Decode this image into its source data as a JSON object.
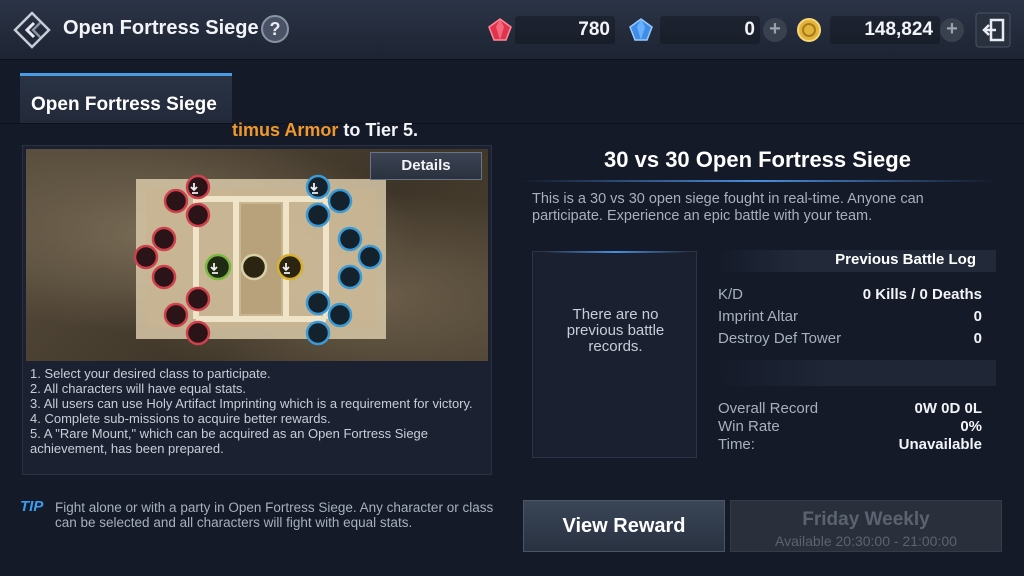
{
  "header": {
    "title": "Open Fortress Siege",
    "help_label": "?",
    "currencies": [
      {
        "icon": "red-gem-icon",
        "value": "780",
        "color": "#e0344e"
      },
      {
        "icon": "blue-gem-icon",
        "value": "0",
        "color": "#3e8ee8"
      },
      {
        "icon": "gold-coin-icon",
        "value": "148,824",
        "color": "#e2b43c"
      }
    ],
    "plus_label": "+"
  },
  "tab": {
    "label": "Open Fortress Siege",
    "accent": "#4a9ae6"
  },
  "banner": {
    "highlight": "timus Armor",
    "rest": " to Tier 5."
  },
  "map": {
    "details_label": "Details",
    "team_colors": {
      "red": "#d0404c",
      "blue": "#3a9ad6",
      "green": "#7ab840",
      "gold": "#d8b030"
    }
  },
  "rules": [
    "1. Select your desired class to participate.",
    "2. All characters will have equal stats.",
    "3. All users can use Holy Artifact Imprinting which is a requirement for victory.",
    "4. Complete sub-missions to acquire better rewards.",
    "5. A \"Rare Mount,\" which can be acquired as an Open Fortress Siege achievement, has been prepared."
  ],
  "mode": {
    "title": "30 vs 30 Open Fortress Siege",
    "description": "This is a 30 vs 30 open siege fought in real-time. Anyone can participate. Experience an epic battle with your team."
  },
  "records": {
    "empty_text": "There are no previous battle records.",
    "log_title": "Previous Battle Log",
    "stats": [
      {
        "label": "K/D",
        "value": "0 Kills / 0 Deaths"
      },
      {
        "label": "Imprint Altar",
        "value": "0"
      },
      {
        "label": "Destroy Def Tower",
        "value": "0"
      }
    ],
    "overall": [
      {
        "label": "Overall Record",
        "value": "0W 0D 0L"
      },
      {
        "label": "Win Rate",
        "value": "0%"
      },
      {
        "label": "Time:",
        "value": "Unavailable"
      }
    ]
  },
  "tip": {
    "label": "TIP",
    "text": "Fight alone or with a party in Open Fortress Siege. Any character or class can be selected and all characters will fight with equal stats."
  },
  "buttons": {
    "view_reward": "View Reward",
    "weekly_title": "Friday Weekly",
    "weekly_time": "Available 20:30:00 - 21:00:00"
  }
}
